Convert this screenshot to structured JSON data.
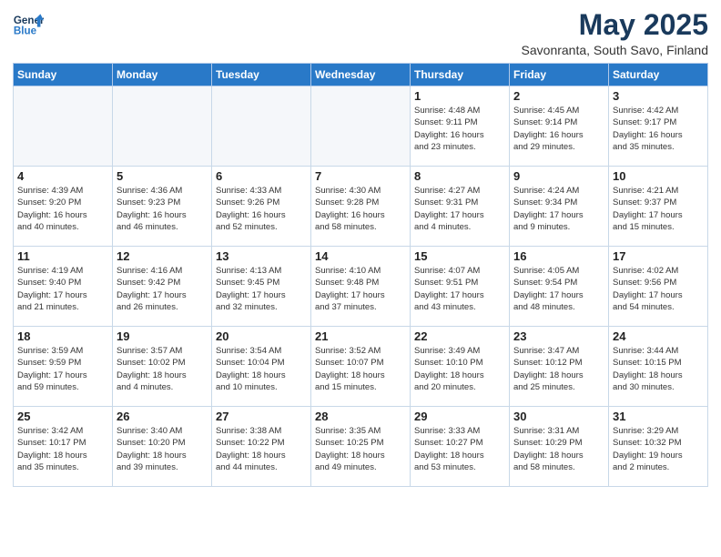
{
  "header": {
    "logo_line1": "General",
    "logo_line2": "Blue",
    "month": "May 2025",
    "location": "Savonranta, South Savo, Finland"
  },
  "days_of_week": [
    "Sunday",
    "Monday",
    "Tuesday",
    "Wednesday",
    "Thursday",
    "Friday",
    "Saturday"
  ],
  "weeks": [
    [
      {
        "day": "",
        "info": ""
      },
      {
        "day": "",
        "info": ""
      },
      {
        "day": "",
        "info": ""
      },
      {
        "day": "",
        "info": ""
      },
      {
        "day": "1",
        "info": "Sunrise: 4:48 AM\nSunset: 9:11 PM\nDaylight: 16 hours\nand 23 minutes."
      },
      {
        "day": "2",
        "info": "Sunrise: 4:45 AM\nSunset: 9:14 PM\nDaylight: 16 hours\nand 29 minutes."
      },
      {
        "day": "3",
        "info": "Sunrise: 4:42 AM\nSunset: 9:17 PM\nDaylight: 16 hours\nand 35 minutes."
      }
    ],
    [
      {
        "day": "4",
        "info": "Sunrise: 4:39 AM\nSunset: 9:20 PM\nDaylight: 16 hours\nand 40 minutes."
      },
      {
        "day": "5",
        "info": "Sunrise: 4:36 AM\nSunset: 9:23 PM\nDaylight: 16 hours\nand 46 minutes."
      },
      {
        "day": "6",
        "info": "Sunrise: 4:33 AM\nSunset: 9:26 PM\nDaylight: 16 hours\nand 52 minutes."
      },
      {
        "day": "7",
        "info": "Sunrise: 4:30 AM\nSunset: 9:28 PM\nDaylight: 16 hours\nand 58 minutes."
      },
      {
        "day": "8",
        "info": "Sunrise: 4:27 AM\nSunset: 9:31 PM\nDaylight: 17 hours\nand 4 minutes."
      },
      {
        "day": "9",
        "info": "Sunrise: 4:24 AM\nSunset: 9:34 PM\nDaylight: 17 hours\nand 9 minutes."
      },
      {
        "day": "10",
        "info": "Sunrise: 4:21 AM\nSunset: 9:37 PM\nDaylight: 17 hours\nand 15 minutes."
      }
    ],
    [
      {
        "day": "11",
        "info": "Sunrise: 4:19 AM\nSunset: 9:40 PM\nDaylight: 17 hours\nand 21 minutes."
      },
      {
        "day": "12",
        "info": "Sunrise: 4:16 AM\nSunset: 9:42 PM\nDaylight: 17 hours\nand 26 minutes."
      },
      {
        "day": "13",
        "info": "Sunrise: 4:13 AM\nSunset: 9:45 PM\nDaylight: 17 hours\nand 32 minutes."
      },
      {
        "day": "14",
        "info": "Sunrise: 4:10 AM\nSunset: 9:48 PM\nDaylight: 17 hours\nand 37 minutes."
      },
      {
        "day": "15",
        "info": "Sunrise: 4:07 AM\nSunset: 9:51 PM\nDaylight: 17 hours\nand 43 minutes."
      },
      {
        "day": "16",
        "info": "Sunrise: 4:05 AM\nSunset: 9:54 PM\nDaylight: 17 hours\nand 48 minutes."
      },
      {
        "day": "17",
        "info": "Sunrise: 4:02 AM\nSunset: 9:56 PM\nDaylight: 17 hours\nand 54 minutes."
      }
    ],
    [
      {
        "day": "18",
        "info": "Sunrise: 3:59 AM\nSunset: 9:59 PM\nDaylight: 17 hours\nand 59 minutes."
      },
      {
        "day": "19",
        "info": "Sunrise: 3:57 AM\nSunset: 10:02 PM\nDaylight: 18 hours\nand 4 minutes."
      },
      {
        "day": "20",
        "info": "Sunrise: 3:54 AM\nSunset: 10:04 PM\nDaylight: 18 hours\nand 10 minutes."
      },
      {
        "day": "21",
        "info": "Sunrise: 3:52 AM\nSunset: 10:07 PM\nDaylight: 18 hours\nand 15 minutes."
      },
      {
        "day": "22",
        "info": "Sunrise: 3:49 AM\nSunset: 10:10 PM\nDaylight: 18 hours\nand 20 minutes."
      },
      {
        "day": "23",
        "info": "Sunrise: 3:47 AM\nSunset: 10:12 PM\nDaylight: 18 hours\nand 25 minutes."
      },
      {
        "day": "24",
        "info": "Sunrise: 3:44 AM\nSunset: 10:15 PM\nDaylight: 18 hours\nand 30 minutes."
      }
    ],
    [
      {
        "day": "25",
        "info": "Sunrise: 3:42 AM\nSunset: 10:17 PM\nDaylight: 18 hours\nand 35 minutes."
      },
      {
        "day": "26",
        "info": "Sunrise: 3:40 AM\nSunset: 10:20 PM\nDaylight: 18 hours\nand 39 minutes."
      },
      {
        "day": "27",
        "info": "Sunrise: 3:38 AM\nSunset: 10:22 PM\nDaylight: 18 hours\nand 44 minutes."
      },
      {
        "day": "28",
        "info": "Sunrise: 3:35 AM\nSunset: 10:25 PM\nDaylight: 18 hours\nand 49 minutes."
      },
      {
        "day": "29",
        "info": "Sunrise: 3:33 AM\nSunset: 10:27 PM\nDaylight: 18 hours\nand 53 minutes."
      },
      {
        "day": "30",
        "info": "Sunrise: 3:31 AM\nSunset: 10:29 PM\nDaylight: 18 hours\nand 58 minutes."
      },
      {
        "day": "31",
        "info": "Sunrise: 3:29 AM\nSunset: 10:32 PM\nDaylight: 19 hours\nand 2 minutes."
      }
    ]
  ]
}
